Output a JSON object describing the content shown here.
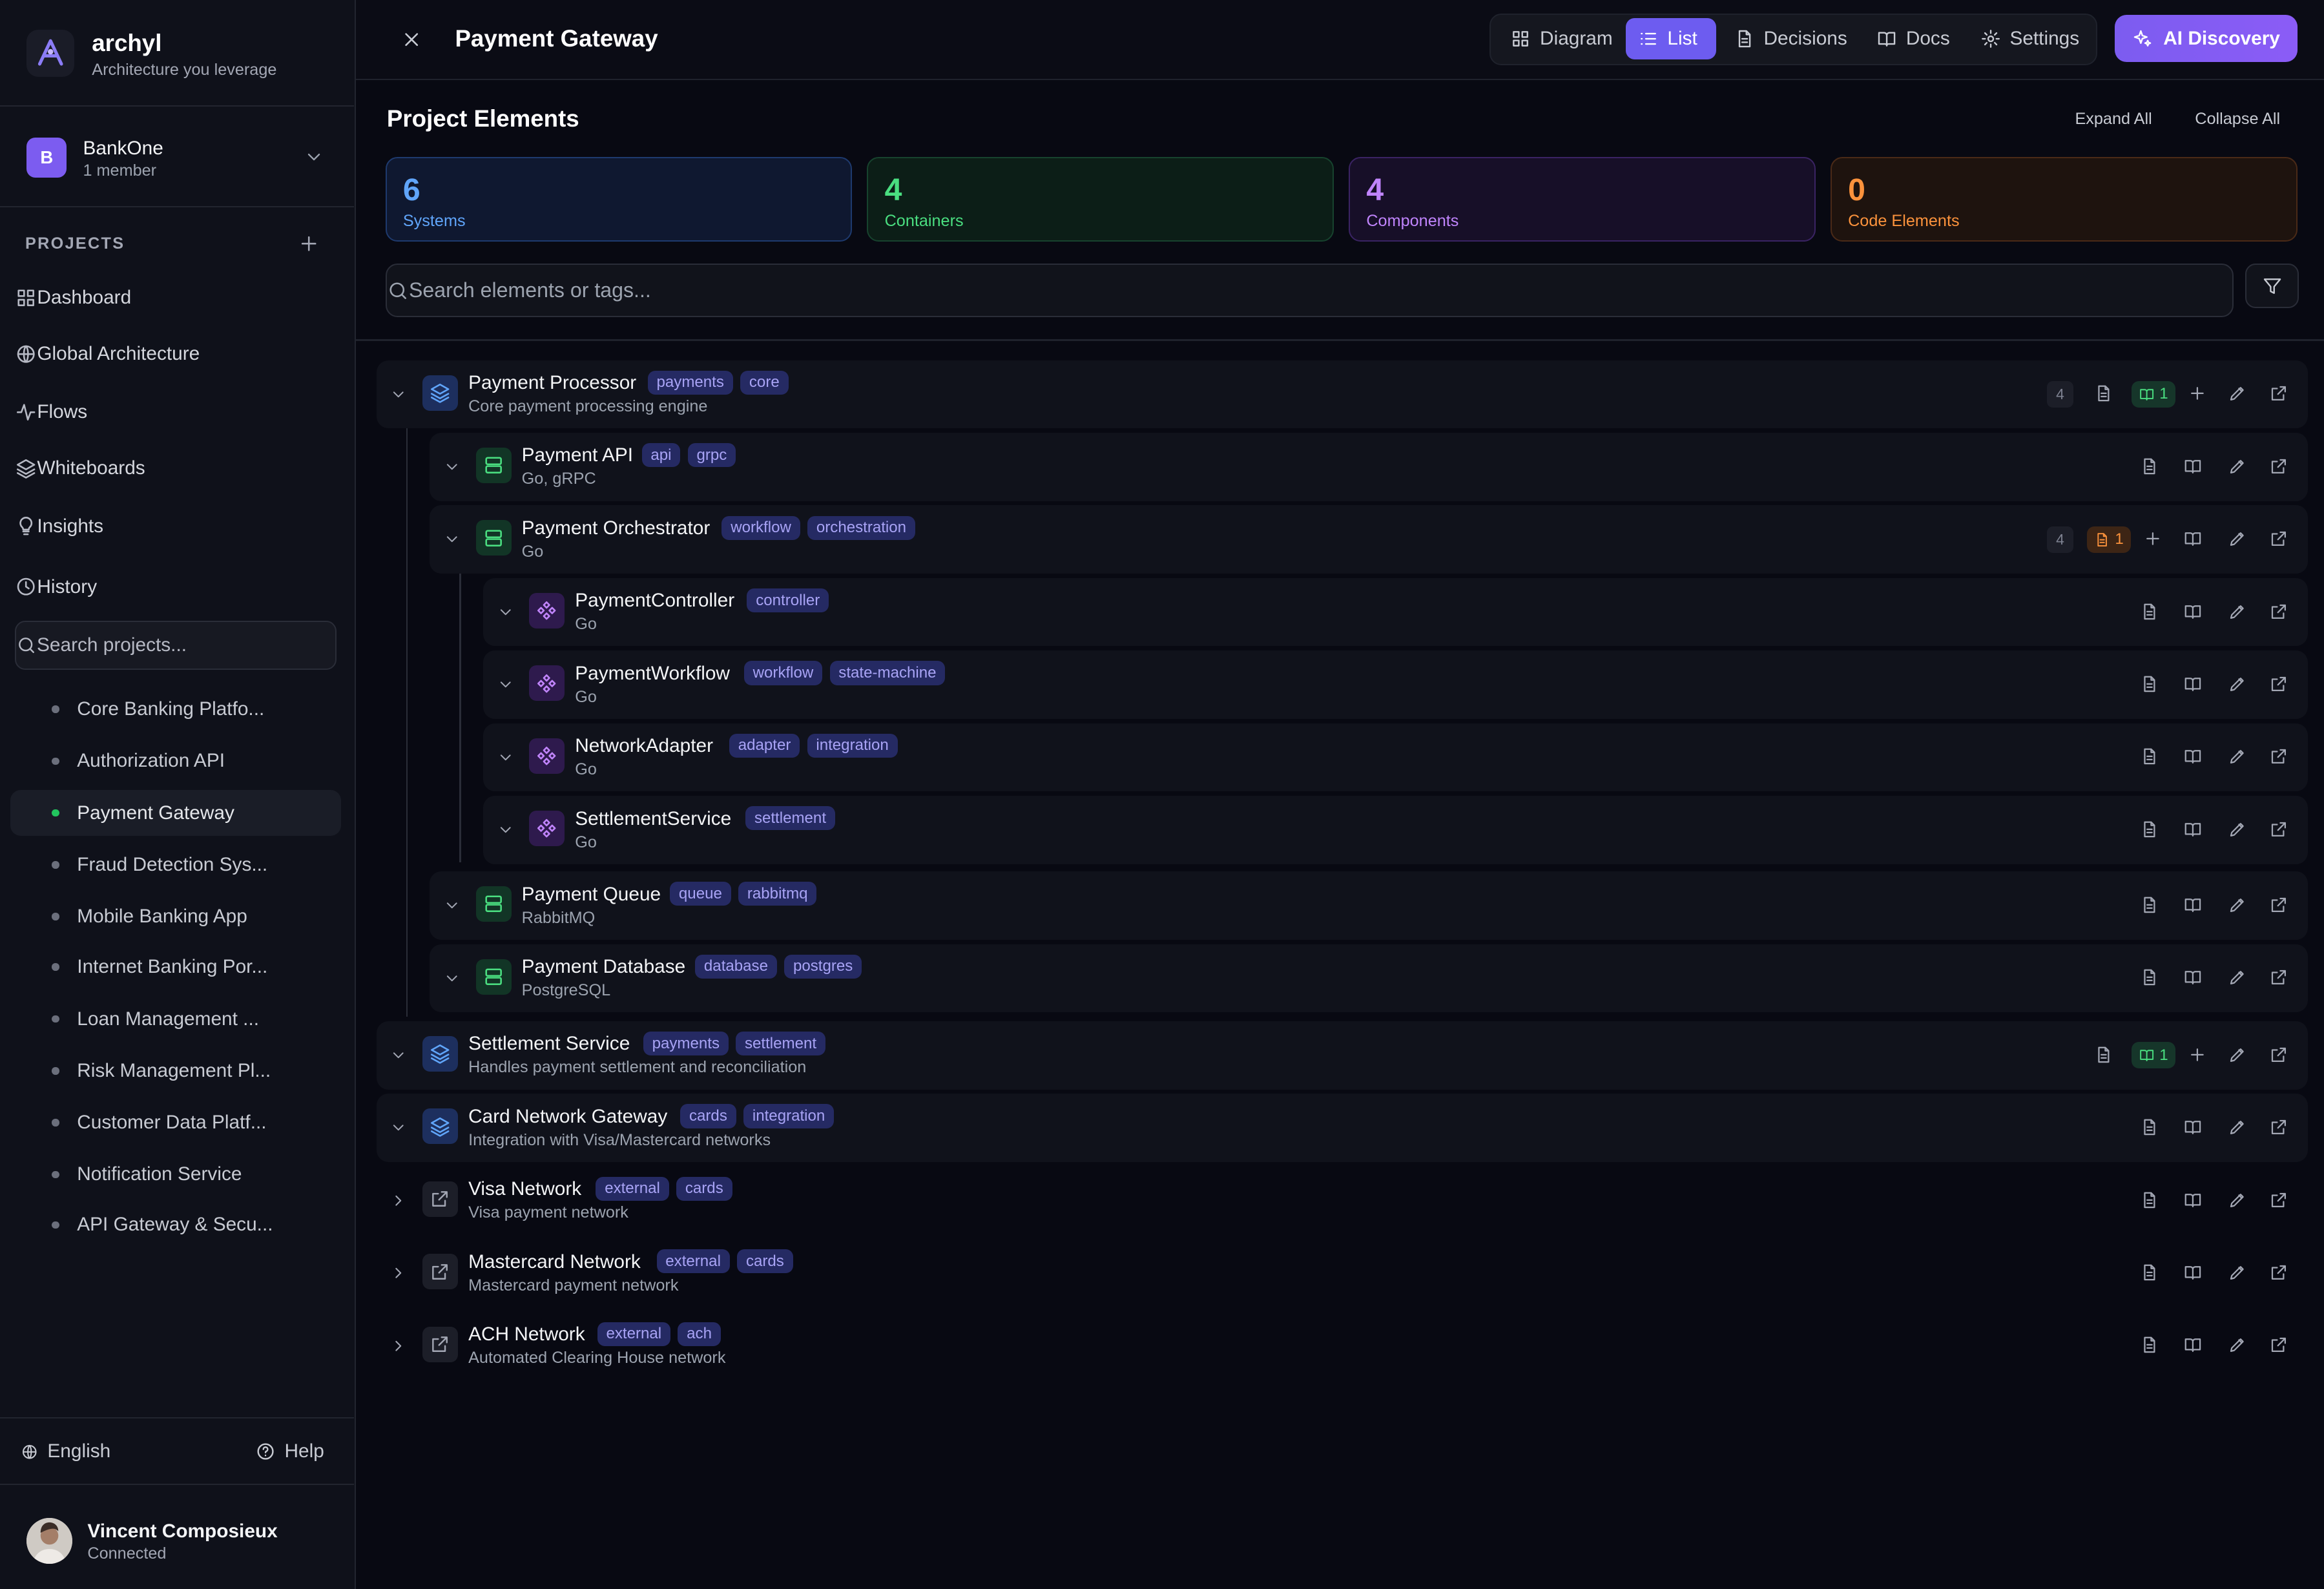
{
  "brand": {
    "name": "archyl",
    "tagline": "Architecture you leverage"
  },
  "org": {
    "initial": "B",
    "name": "BankOne",
    "members": "1 member"
  },
  "sidebar": {
    "projects_heading": "PROJECTS",
    "nav": [
      {
        "label": "Dashboard",
        "icon": "grid-icon"
      },
      {
        "label": "Global Architecture",
        "icon": "globe-icon"
      },
      {
        "label": "Flows",
        "icon": "activity-icon"
      },
      {
        "label": "Whiteboards",
        "icon": "layers-icon"
      },
      {
        "label": "Insights",
        "icon": "lightbulb-icon"
      },
      {
        "label": "History",
        "icon": "clock-icon"
      }
    ],
    "search_placeholder": "Search projects...",
    "projects": [
      "Core Banking Platfo...",
      "Authorization API",
      "Payment Gateway",
      "Fraud Detection Sys...",
      "Mobile Banking App",
      "Internet Banking Por...",
      "Loan Management ...",
      "Risk Management Pl...",
      "Customer Data Platf...",
      "Notification Service",
      "API Gateway & Secu..."
    ],
    "language": "English",
    "help": "Help"
  },
  "user": {
    "name": "Vincent Composieux",
    "status": "Connected"
  },
  "topbar": {
    "title": "Payment Gateway",
    "views": [
      "Diagram",
      "List",
      "Decisions",
      "Docs",
      "Settings"
    ],
    "active_view": "List",
    "ai_label": "AI Discovery"
  },
  "section": {
    "title": "Project Elements",
    "expand_all": "Expand All",
    "collapse_all": "Collapse All"
  },
  "stats": [
    {
      "count": "6",
      "label": "Systems",
      "color": "#60a5fa"
    },
    {
      "count": "4",
      "label": "Containers",
      "color": "#4ade80"
    },
    {
      "count": "4",
      "label": "Components",
      "color": "#c084fc"
    },
    {
      "count": "0",
      "label": "Code Elements",
      "color": "#fb923c"
    }
  ],
  "search_placeholder": "Search elements or tags...",
  "elements": [
    {
      "name": "Payment Processor",
      "desc": "Core payment processing engine",
      "tags": [
        "payments",
        "core"
      ],
      "type": "system",
      "count": "4",
      "docs": "1"
    },
    {
      "name": "Payment API",
      "desc": "Go, gRPC",
      "tags": [
        "api",
        "grpc"
      ],
      "type": "container"
    },
    {
      "name": "Payment Orchestrator",
      "desc": "Go",
      "tags": [
        "workflow",
        "orchestration"
      ],
      "type": "container",
      "count": "4",
      "decisions": "1"
    },
    {
      "name": "PaymentController",
      "desc": "Go",
      "tags": [
        "controller"
      ],
      "type": "component"
    },
    {
      "name": "PaymentWorkflow",
      "desc": "Go",
      "tags": [
        "workflow",
        "state-machine"
      ],
      "type": "component"
    },
    {
      "name": "NetworkAdapter",
      "desc": "Go",
      "tags": [
        "adapter",
        "integration"
      ],
      "type": "component"
    },
    {
      "name": "SettlementService",
      "desc": "Go",
      "tags": [
        "settlement"
      ],
      "type": "component"
    },
    {
      "name": "Payment Queue",
      "desc": "RabbitMQ",
      "tags": [
        "queue",
        "rabbitmq"
      ],
      "type": "container"
    },
    {
      "name": "Payment Database",
      "desc": "PostgreSQL",
      "tags": [
        "database",
        "postgres"
      ],
      "type": "container"
    },
    {
      "name": "Settlement Service",
      "desc": "Handles payment settlement and reconciliation",
      "tags": [
        "payments",
        "settlement"
      ],
      "type": "system",
      "docs": "1"
    },
    {
      "name": "Card Network Gateway",
      "desc": "Integration with Visa/Mastercard networks",
      "tags": [
        "cards",
        "integration"
      ],
      "type": "system"
    },
    {
      "name": "Visa Network",
      "desc": "Visa payment network",
      "tags": [
        "external",
        "cards"
      ],
      "type": "external"
    },
    {
      "name": "Mastercard Network",
      "desc": "Mastercard payment network",
      "tags": [
        "external",
        "cards"
      ],
      "type": "external"
    },
    {
      "name": "ACH Network",
      "desc": "Automated Clearing House network",
      "tags": [
        "external",
        "ach"
      ],
      "type": "external"
    }
  ]
}
